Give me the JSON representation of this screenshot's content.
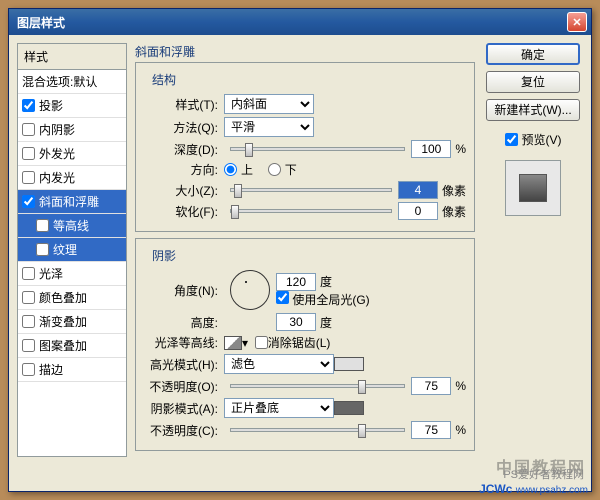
{
  "window": {
    "title": "图层样式"
  },
  "styles": {
    "header": "样式",
    "blend": "混合选项:默认",
    "items": [
      {
        "label": "投影",
        "checked": true,
        "selected": false
      },
      {
        "label": "内阴影",
        "checked": false
      },
      {
        "label": "外发光",
        "checked": false
      },
      {
        "label": "内发光",
        "checked": false
      },
      {
        "label": "斜面和浮雕",
        "checked": true,
        "selected": true
      },
      {
        "label": "等高线",
        "checked": false,
        "sub": true,
        "selected": true
      },
      {
        "label": "纹理",
        "checked": false,
        "sub": true,
        "selected": true
      },
      {
        "label": "光泽",
        "checked": false
      },
      {
        "label": "颜色叠加",
        "checked": false
      },
      {
        "label": "渐变叠加",
        "checked": false
      },
      {
        "label": "图案叠加",
        "checked": false
      },
      {
        "label": "描边",
        "checked": false
      }
    ]
  },
  "bevel": {
    "title": "斜面和浮雕",
    "struct": "结构",
    "style_l": "样式(T):",
    "style_v": "内斜面",
    "tech_l": "方法(Q):",
    "tech_v": "平滑",
    "depth_l": "深度(D):",
    "depth_v": "100",
    "depth_u": "%",
    "dir_l": "方向:",
    "up": "上",
    "down": "下",
    "size_l": "大小(Z):",
    "size_v": "4",
    "size_u": "像素",
    "soft_l": "软化(F):",
    "soft_v": "0",
    "soft_u": "像素",
    "shading": "阴影",
    "angle_l": "角度(N):",
    "angle_v": "120",
    "angle_u": "度",
    "global": "使用全局光(G)",
    "alt_l": "高度:",
    "alt_v": "30",
    "alt_u": "度",
    "gloss_l": "光泽等高线:",
    "anti": "消除锯齿(L)",
    "hmode_l": "高光模式(H):",
    "hmode_v": "滤色",
    "hop_l": "不透明度(O):",
    "hop_v": "75",
    "hop_u": "%",
    "smode_l": "阴影模式(A):",
    "smode_v": "正片叠底",
    "sop_l": "不透明度(C):",
    "sop_v": "75",
    "sop_u": "%"
  },
  "buttons": {
    "ok": "确定",
    "reset": "复位",
    "newstyle": "新建样式(W)...",
    "preview": "预览(V)"
  },
  "footer": {
    "wm": "JCWc",
    "url": "www.psahz.com",
    "sub": "PS爱好者教程网",
    "cn": "中国教程网"
  }
}
